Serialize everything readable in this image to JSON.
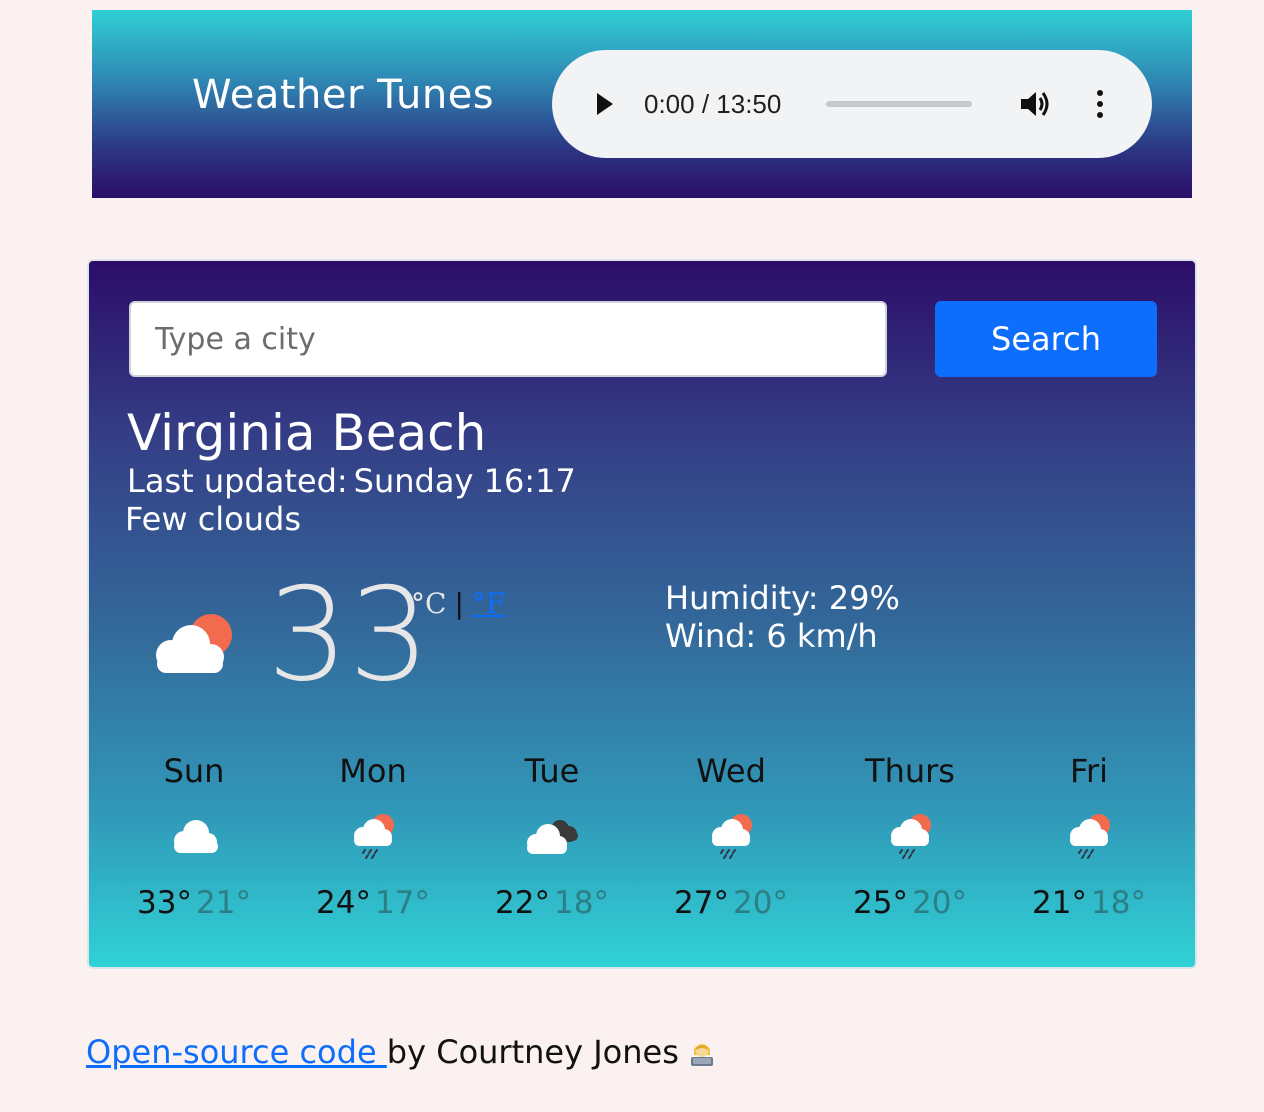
{
  "header": {
    "title": "Weather Tunes",
    "audio": {
      "time_display": "0:00 / 13:50",
      "progress": 0,
      "play_icon": "play-icon",
      "volume_icon": "volume-icon",
      "more_icon": "more-vert-icon"
    }
  },
  "search": {
    "placeholder": "Type a city",
    "button_label": "Search"
  },
  "current": {
    "city": "Virginia Beach",
    "last_updated_label": "Last updated:",
    "last_updated_value": "Sunday 16:17",
    "description": "Few clouds",
    "temperature": "33",
    "unit_c": "°C",
    "unit_separator": "|",
    "unit_f": "°F",
    "humidity_label": "Humidity:",
    "humidity_value": "29%",
    "wind_label": "Wind:",
    "wind_value": "6 km/h",
    "icon": "few-clouds-icon"
  },
  "forecast": [
    {
      "day": "Sun",
      "max": "33°",
      "min": "21°",
      "icon": "cloud-icon"
    },
    {
      "day": "Mon",
      "max": "24°",
      "min": "17°",
      "icon": "rain-sun-icon"
    },
    {
      "day": "Tue",
      "max": "22°",
      "min": "18°",
      "icon": "dark-clouds-icon"
    },
    {
      "day": "Wed",
      "max": "27°",
      "min": "20°",
      "icon": "rain-sun-icon"
    },
    {
      "day": "Thurs",
      "max": "25°",
      "min": "20°",
      "icon": "rain-sun-icon"
    },
    {
      "day": "Fri",
      "max": "21°",
      "min": "18°",
      "icon": "rain-sun-icon"
    }
  ],
  "footer": {
    "link_text": "Open-source code ",
    "byline": "by Courtney Jones",
    "emoji_icon": "technologist-icon"
  },
  "colors": {
    "page_background": "#fbf1f0",
    "accent_blue": "#0d6efd",
    "card_gradient_top": "#2c0d68",
    "card_gradient_bottom": "#2fd2d6",
    "min_temp": "#2d7f86"
  }
}
